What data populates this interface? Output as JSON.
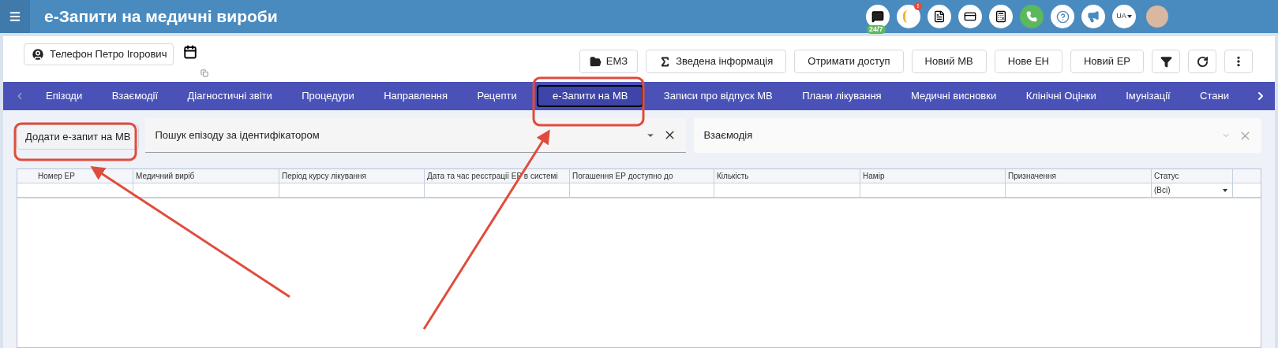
{
  "header": {
    "title": "е-Запити на медичні вироби",
    "support_badge": "24/7",
    "alert_badge": "!",
    "language": "UA"
  },
  "patient": {
    "name": "Телефон Петро Ігорович"
  },
  "actions": [
    {
      "label": "ЕМЗ",
      "kind": "folder"
    },
    {
      "label": "Зведена інформація",
      "kind": "sum"
    },
    {
      "label": "Отримати доступ",
      "kind": "text"
    },
    {
      "label": "Новий МВ",
      "kind": "text"
    },
    {
      "label": "Нове ЕН",
      "kind": "text"
    },
    {
      "label": "Новий ЕР",
      "kind": "text"
    },
    {
      "kind": "filter"
    },
    {
      "kind": "refresh"
    },
    {
      "kind": "more"
    }
  ],
  "tabs": [
    {
      "label": "Епізоди",
      "selected": false
    },
    {
      "label": "Взаємодії",
      "selected": false
    },
    {
      "label": "Діагностичні звіти",
      "selected": false
    },
    {
      "label": "Процедури",
      "selected": false
    },
    {
      "label": "Направлення",
      "selected": false
    },
    {
      "label": "Рецепти",
      "selected": false
    },
    {
      "label": "е-Запити на МВ",
      "selected": true
    },
    {
      "label": "Записи про відпуск МВ",
      "selected": false
    },
    {
      "label": "Плани лікування",
      "selected": false
    },
    {
      "label": "Медичні висновки",
      "selected": false
    },
    {
      "label": "Клінічні Оцінки",
      "selected": false
    },
    {
      "label": "Імунізації",
      "selected": false
    },
    {
      "label": "Стани",
      "selected": false
    }
  ],
  "add_button": "Додати е-запит на МВ",
  "episode_search": {
    "value": "Пошук епізоду за ідентифікатором"
  },
  "interaction_filter": {
    "value": "Взаємодія"
  },
  "table": {
    "columns": [
      "Номер ЕР",
      "Медичний виріб",
      "Період курсу лікування",
      "Дата та час реєстрації ЕР в системі",
      "Погашення ЕР доступно до",
      "Кількість",
      "Намір",
      "Призначення",
      "Статус"
    ],
    "status_filter": "(Всі)"
  }
}
